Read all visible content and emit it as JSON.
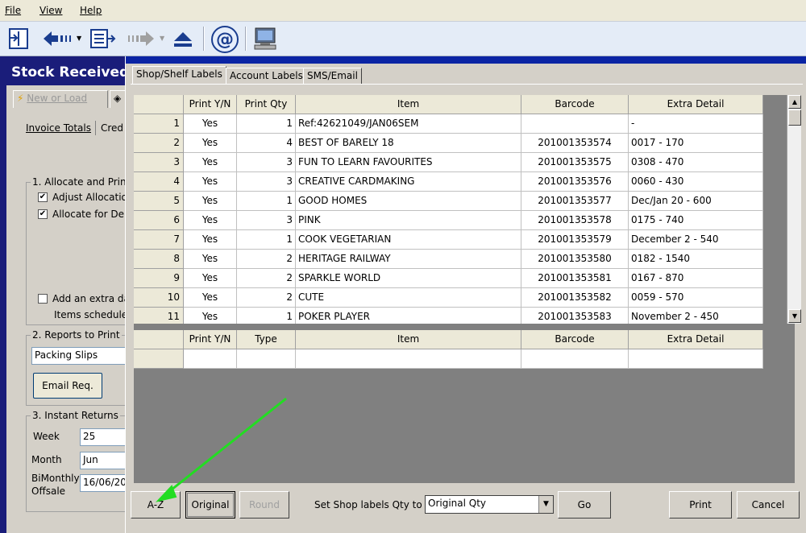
{
  "menubar": {
    "file": "File",
    "view": "View",
    "help": "Help"
  },
  "toolbar": {
    "icons": [
      "import-icon",
      "back-icon",
      "list-icon",
      "forward-icon",
      "eject-icon",
      "email-icon",
      "computer-icon"
    ]
  },
  "background": {
    "title": "Stock Received",
    "tabs": {
      "new_or_load": "New or Load"
    },
    "subtabs": {
      "invoice_totals": "Invoice Totals",
      "credit": "Cred"
    },
    "section1": {
      "title": "1. Allocate and Prin",
      "adjust": "Adjust Allocation",
      "allocate": "Allocate for Deli",
      "extra": "Add an extra da",
      "scheduled": "Items schedule"
    },
    "section2": {
      "title": "2. Reports to Print",
      "report_value": "Packing Slips",
      "email_btn": "Email Req."
    },
    "section3": {
      "title": "3. Instant Returns",
      "week_label": "Week",
      "week_value": "25",
      "month_label": "Month",
      "month_value": "Jun",
      "bimonthly_label1": "BiMonthly",
      "bimonthly_label2": "Offsale",
      "bimonthly_value": "16/06/20"
    }
  },
  "dialog": {
    "tabs": [
      "Shop/Shelf Labels",
      "Account Labels",
      "SMS/Email"
    ],
    "grid1": {
      "headers": [
        "Print Y/N",
        "Print Qty",
        "Item",
        "Barcode",
        "Extra Detail"
      ],
      "rows": [
        {
          "n": "1",
          "yn": "Yes",
          "qty": "1",
          "item": "Ref:42621049/JAN06SEM",
          "barcode": "",
          "extra": "-"
        },
        {
          "n": "2",
          "yn": "Yes",
          "qty": "4",
          "item": "BEST OF BARELY 18",
          "barcode": "201001353574",
          "extra": "0017 - 170"
        },
        {
          "n": "3",
          "yn": "Yes",
          "qty": "3",
          "item": "FUN TO LEARN FAVOURITES",
          "barcode": "201001353575",
          "extra": "0308 - 470"
        },
        {
          "n": "4",
          "yn": "Yes",
          "qty": "3",
          "item": "CREATIVE CARDMAKING",
          "barcode": "201001353576",
          "extra": "0060 - 430"
        },
        {
          "n": "5",
          "yn": "Yes",
          "qty": "1",
          "item": "GOOD HOMES",
          "barcode": "201001353577",
          "extra": "Dec/Jan 20 - 600"
        },
        {
          "n": "6",
          "yn": "Yes",
          "qty": "3",
          "item": "PINK",
          "barcode": "201001353578",
          "extra": "0175 - 740"
        },
        {
          "n": "7",
          "yn": "Yes",
          "qty": "1",
          "item": "COOK VEGETARIAN",
          "barcode": "201001353579",
          "extra": "December 2 - 540"
        },
        {
          "n": "8",
          "yn": "Yes",
          "qty": "2",
          "item": "HERITAGE RAILWAY",
          "barcode": "201001353580",
          "extra": "0182 - 1540"
        },
        {
          "n": "9",
          "yn": "Yes",
          "qty": "2",
          "item": "SPARKLE WORLD",
          "barcode": "201001353581",
          "extra": "0167 - 870"
        },
        {
          "n": "10",
          "yn": "Yes",
          "qty": "2",
          "item": "CUTE",
          "barcode": "201001353582",
          "extra": "0059 - 570"
        },
        {
          "n": "11",
          "yn": "Yes",
          "qty": "1",
          "item": "POKER PLAYER",
          "barcode": "201001353583",
          "extra": "November 2 - 450"
        }
      ]
    },
    "grid2": {
      "headers": [
        "Print Y/N",
        "Type",
        "Item",
        "Barcode",
        "Extra Detail"
      ]
    },
    "bottom": {
      "az": "A-Z",
      "original": "Original",
      "round": "Round",
      "set_label": "Set Shop labels Qty to",
      "qty_select": "Original Qty",
      "go": "Go",
      "print": "Print",
      "cancel": "Cancel"
    }
  },
  "colors": {
    "title_bar": "#0a24a4",
    "bg_panel": "#1a1d7a",
    "annotation_arrow": "#22dd22"
  }
}
